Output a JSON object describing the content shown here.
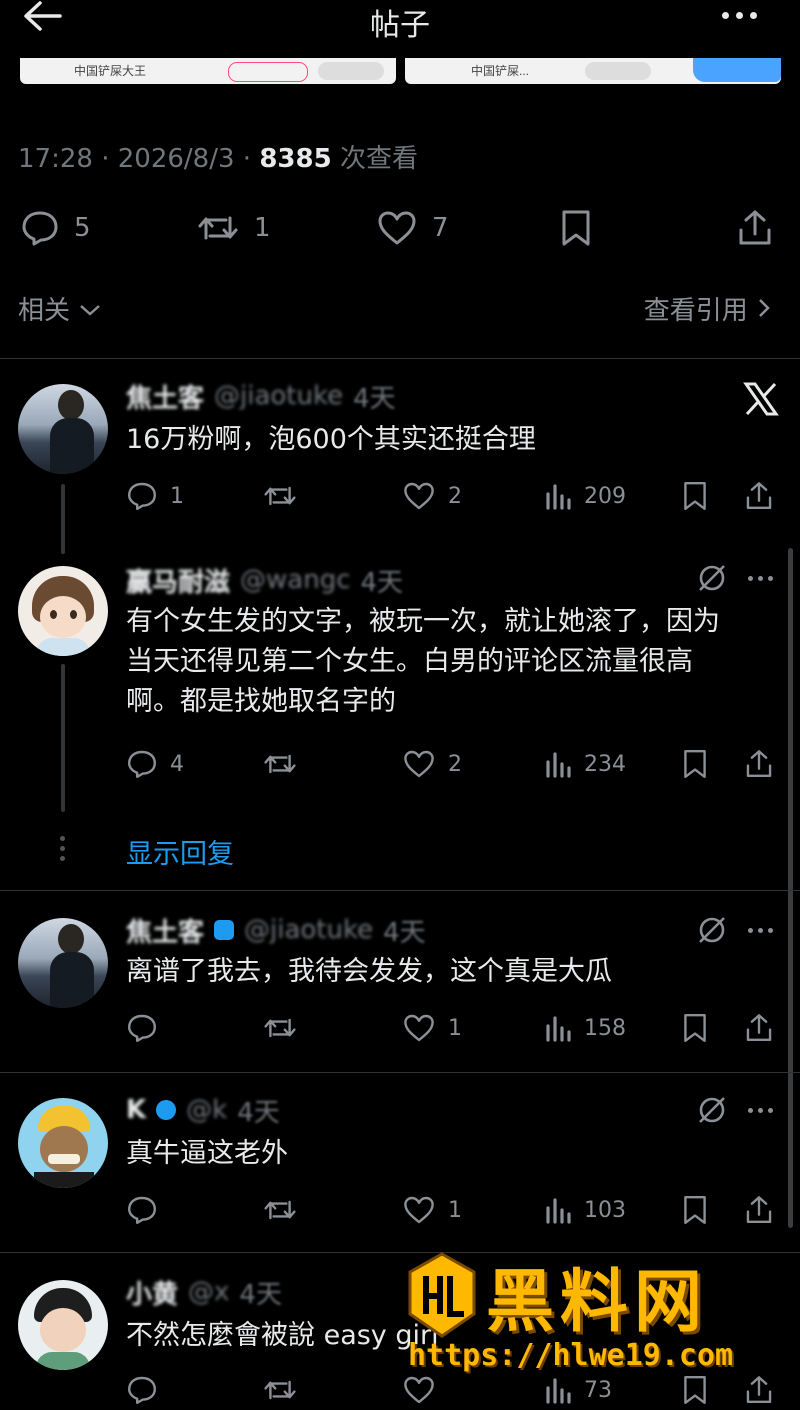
{
  "header": {
    "title": "帖子",
    "back_icon": "arrow-left-icon",
    "more_icon": "more-horizontal-icon"
  },
  "thumbnails": [
    {
      "label": "中国铲屎大王"
    },
    {
      "label": "中国铲屎..."
    }
  ],
  "post_meta": {
    "time": "17:28",
    "date": "2026/8/3",
    "views": "8385",
    "views_suffix": "次查看",
    "separator": "·"
  },
  "post_stats": {
    "replies": "5",
    "reposts": "1",
    "likes": "7"
  },
  "related": {
    "label": "相关",
    "quotes_label": "查看引用"
  },
  "replies": [
    {
      "name": "焦土客",
      "handle": "@jiaotuke",
      "time": "4天",
      "text": "16万粉啊，泡600个其实还挺合理",
      "reply_count": "1",
      "repost_count": "",
      "like_count": "2",
      "view_count": "209",
      "badge": "x-logo-icon"
    },
    {
      "name": "赢马耐滋",
      "handle": "@wangc",
      "time": "4天",
      "text": "有个女生发的文字，被玩一次，就让她滚了，因为当天还得见第二个女生。白男的评论区流量很高啊。都是找她取名字的",
      "reply_count": "4",
      "repost_count": "",
      "like_count": "2",
      "view_count": "234"
    },
    {
      "name": "焦土客",
      "handle": "@jiaotuke",
      "time": "4天",
      "text": "离谱了我去，我待会发发，这个真是大瓜",
      "reply_count": "",
      "repost_count": "",
      "like_count": "1",
      "view_count": "158"
    },
    {
      "name": "K",
      "handle": "@k",
      "time": "4天",
      "text": "真牛逼这老外",
      "reply_count": "",
      "repost_count": "",
      "like_count": "1",
      "view_count": "103"
    },
    {
      "name": "小黄",
      "handle": "@x",
      "time": "4天",
      "text": "不然怎麼會被說 easy girl",
      "reply_count": "",
      "repost_count": "",
      "like_count": "",
      "view_count": "73"
    }
  ],
  "show_replies_label": "显示回复",
  "watermark": {
    "big": "黑料网",
    "url": "https://hlwe19.com"
  },
  "colors": {
    "background": "#000000",
    "text": "#e7e9ea",
    "muted": "#71767b",
    "link": "#1d9bf0",
    "watermark": "#ffb800"
  }
}
